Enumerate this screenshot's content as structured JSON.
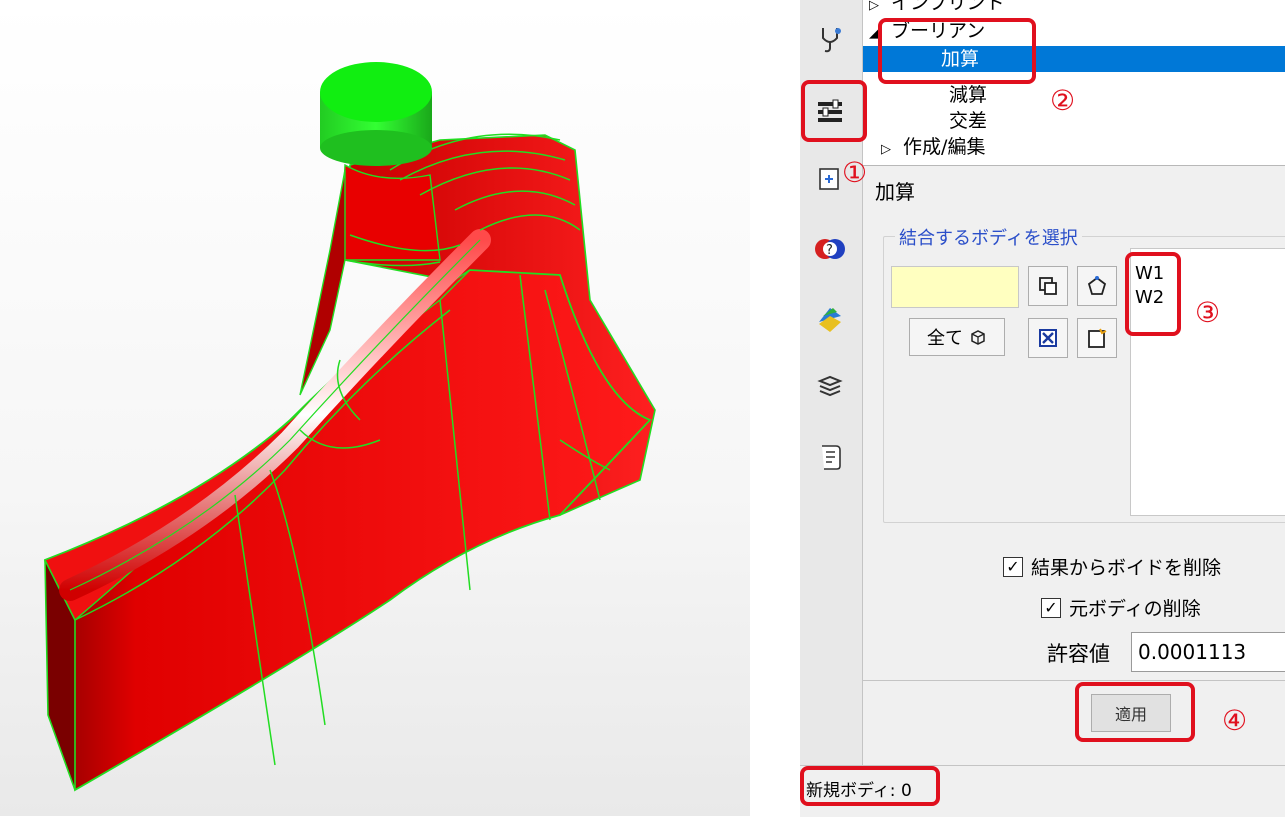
{
  "tree": {
    "items": [
      {
        "label": "インプリント",
        "arrow": "▷"
      },
      {
        "label": "ブーリアン",
        "arrow": "◢"
      },
      {
        "label": "加算",
        "arrow": ""
      },
      {
        "label": "減算",
        "arrow": ""
      },
      {
        "label": "交差",
        "arrow": ""
      },
      {
        "label": "作成/編集",
        "arrow": "▷"
      }
    ],
    "selected": "加算"
  },
  "panel": {
    "title": "加算",
    "group_label": "結合するボディを選択",
    "all_button": "全て",
    "bodies": [
      "W1",
      "W2"
    ],
    "option_remove_voids": "結果からボイドを削除",
    "option_remove_voids_checked": true,
    "option_delete_original": "元ボディの削除",
    "option_delete_original_checked": true,
    "tolerance_label": "許容値",
    "tolerance_value": "0.0001113",
    "apply_button": "適用"
  },
  "status": {
    "text": "新規ボディ: 0"
  },
  "annotations": [
    "①",
    "②",
    "③",
    "④"
  ],
  "icons": {
    "toolbar": [
      "stethoscope-icon",
      "tools-icon",
      "add-sheet-icon",
      "help-icon",
      "layers-color-icon",
      "stack-icon",
      "script-icon"
    ]
  },
  "colors": {
    "model_body": "#e00000",
    "model_edges": "#22dd22",
    "model_cylinder": "#00dd00",
    "tree_selection": "#0078d7",
    "annotation": "#e0101e",
    "selection_field": "#ffffc0"
  }
}
